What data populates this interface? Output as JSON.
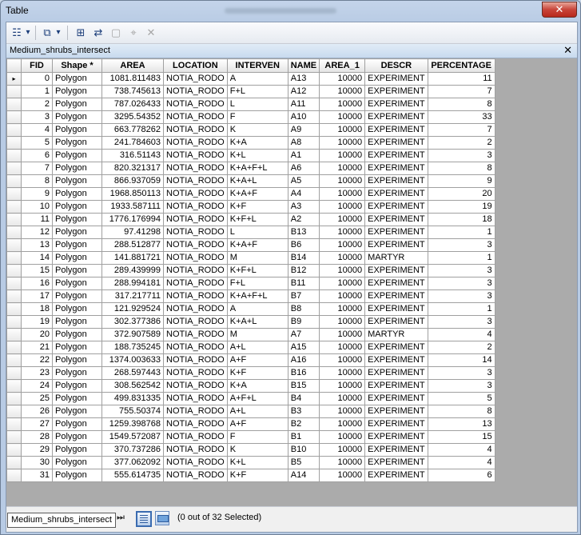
{
  "window": {
    "title": "Table",
    "close_glyph": "✕"
  },
  "toolbar": {
    "icons": [
      "table-options-icon",
      "related-tables-icon",
      "select-by-attributes-icon",
      "switch-selection-icon",
      "clear-selection-icon",
      "zoom-to-selected-icon",
      "delete-selected-icon"
    ],
    "glyphs": {
      "options": "☷",
      "dropdown": "▾",
      "related": "⧉",
      "select_by_attr": "⊞",
      "switch_selection": "⇄",
      "clear_selection": "▢",
      "zoom_selected": "⌖",
      "delete_selected": "✕"
    }
  },
  "table_tab": {
    "name": "Medium_shrubs_intersect",
    "close_glyph": "✕"
  },
  "columns": [
    "FID",
    "Shape *",
    "AREA",
    "LOCATION",
    "INTERVEN",
    "NAME",
    "AREA_1",
    "DESCR",
    "PERCENTAGE"
  ],
  "rows": [
    [
      "0",
      "Polygon",
      "1081.811483",
      "NOTIA_RODO",
      "A",
      "A13",
      "10000",
      "EXPERIMENT",
      "11"
    ],
    [
      "1",
      "Polygon",
      "738.745613",
      "NOTIA_RODO",
      "F+L",
      "A12",
      "10000",
      "EXPERIMENT",
      "7"
    ],
    [
      "2",
      "Polygon",
      "787.026433",
      "NOTIA_RODO",
      "L",
      "A11",
      "10000",
      "EXPERIMENT",
      "8"
    ],
    [
      "3",
      "Polygon",
      "3295.54352",
      "NOTIA_RODO",
      "F",
      "A10",
      "10000",
      "EXPERIMENT",
      "33"
    ],
    [
      "4",
      "Polygon",
      "663.778262",
      "NOTIA_RODO",
      "K",
      "A9",
      "10000",
      "EXPERIMENT",
      "7"
    ],
    [
      "5",
      "Polygon",
      "241.784603",
      "NOTIA_RODO",
      "K+A",
      "A8",
      "10000",
      "EXPERIMENT",
      "2"
    ],
    [
      "6",
      "Polygon",
      "316.51143",
      "NOTIA_RODO",
      "K+L",
      "A1",
      "10000",
      "EXPERIMENT",
      "3"
    ],
    [
      "7",
      "Polygon",
      "820.321317",
      "NOTIA_RODO",
      "K+A+F+L",
      "A6",
      "10000",
      "EXPERIMENT",
      "8"
    ],
    [
      "8",
      "Polygon",
      "866.937059",
      "NOTIA_RODO",
      "K+A+L",
      "A5",
      "10000",
      "EXPERIMENT",
      "9"
    ],
    [
      "9",
      "Polygon",
      "1968.850113",
      "NOTIA_RODO",
      "K+A+F",
      "A4",
      "10000",
      "EXPERIMENT",
      "20"
    ],
    [
      "10",
      "Polygon",
      "1933.587111",
      "NOTIA_RODO",
      "K+F",
      "A3",
      "10000",
      "EXPERIMENT",
      "19"
    ],
    [
      "11",
      "Polygon",
      "1776.176994",
      "NOTIA_RODO",
      "K+F+L",
      "A2",
      "10000",
      "EXPERIMENT",
      "18"
    ],
    [
      "12",
      "Polygon",
      "97.41298",
      "NOTIA_RODO",
      "L",
      "B13",
      "10000",
      "EXPERIMENT",
      "1"
    ],
    [
      "13",
      "Polygon",
      "288.512877",
      "NOTIA_RODO",
      "K+A+F",
      "B6",
      "10000",
      "EXPERIMENT",
      "3"
    ],
    [
      "14",
      "Polygon",
      "141.881721",
      "NOTIA_RODO",
      "M",
      "B14",
      "10000",
      "MARTYR",
      "1"
    ],
    [
      "15",
      "Polygon",
      "289.439999",
      "NOTIA_RODO",
      "K+F+L",
      "B12",
      "10000",
      "EXPERIMENT",
      "3"
    ],
    [
      "16",
      "Polygon",
      "288.994181",
      "NOTIA_RODO",
      "F+L",
      "B11",
      "10000",
      "EXPERIMENT",
      "3"
    ],
    [
      "17",
      "Polygon",
      "317.217711",
      "NOTIA_RODO",
      "K+A+F+L",
      "B7",
      "10000",
      "EXPERIMENT",
      "3"
    ],
    [
      "18",
      "Polygon",
      "121.929524",
      "NOTIA_RODO",
      "A",
      "B8",
      "10000",
      "EXPERIMENT",
      "1"
    ],
    [
      "19",
      "Polygon",
      "302.377386",
      "NOTIA_RODO",
      "K+A+L",
      "B9",
      "10000",
      "EXPERIMENT",
      "3"
    ],
    [
      "20",
      "Polygon",
      "372.907589",
      "NOTIA_RODO",
      "M",
      "A7",
      "10000",
      "MARTYR",
      "4"
    ],
    [
      "21",
      "Polygon",
      "188.735245",
      "NOTIA_RODO",
      "A+L",
      "A15",
      "10000",
      "EXPERIMENT",
      "2"
    ],
    [
      "22",
      "Polygon",
      "1374.003633",
      "NOTIA_RODO",
      "A+F",
      "A16",
      "10000",
      "EXPERIMENT",
      "14"
    ],
    [
      "23",
      "Polygon",
      "268.597443",
      "NOTIA_RODO",
      "K+F",
      "B16",
      "10000",
      "EXPERIMENT",
      "3"
    ],
    [
      "24",
      "Polygon",
      "308.562542",
      "NOTIA_RODO",
      "K+A",
      "B15",
      "10000",
      "EXPERIMENT",
      "3"
    ],
    [
      "25",
      "Polygon",
      "499.831335",
      "NOTIA_RODO",
      "A+F+L",
      "B4",
      "10000",
      "EXPERIMENT",
      "5"
    ],
    [
      "26",
      "Polygon",
      "755.50374",
      "NOTIA_RODO",
      "A+L",
      "B3",
      "10000",
      "EXPERIMENT",
      "8"
    ],
    [
      "27",
      "Polygon",
      "1259.398768",
      "NOTIA_RODO",
      "A+F",
      "B2",
      "10000",
      "EXPERIMENT",
      "13"
    ],
    [
      "28",
      "Polygon",
      "1549.572087",
      "NOTIA_RODO",
      "F",
      "B1",
      "10000",
      "EXPERIMENT",
      "15"
    ],
    [
      "29",
      "Polygon",
      "370.737286",
      "NOTIA_RODO",
      "K",
      "B10",
      "10000",
      "EXPERIMENT",
      "4"
    ],
    [
      "30",
      "Polygon",
      "377.062092",
      "NOTIA_RODO",
      "K+L",
      "B5",
      "10000",
      "EXPERIMENT",
      "4"
    ],
    [
      "31",
      "Polygon",
      "555.614735",
      "NOTIA_RODO",
      "K+F",
      "A14",
      "10000",
      "EXPERIMENT",
      "6"
    ]
  ],
  "current_row_marker": "▸",
  "statusbar": {
    "first_glyph": "⏮",
    "prev_glyph": "◂",
    "page": "1",
    "next_glyph": "▸",
    "last_glyph": "⏭",
    "selection_text": "(0 out of 32 Selected)"
  },
  "bottom_tab": {
    "name": "Medium_shrubs_intersect"
  }
}
